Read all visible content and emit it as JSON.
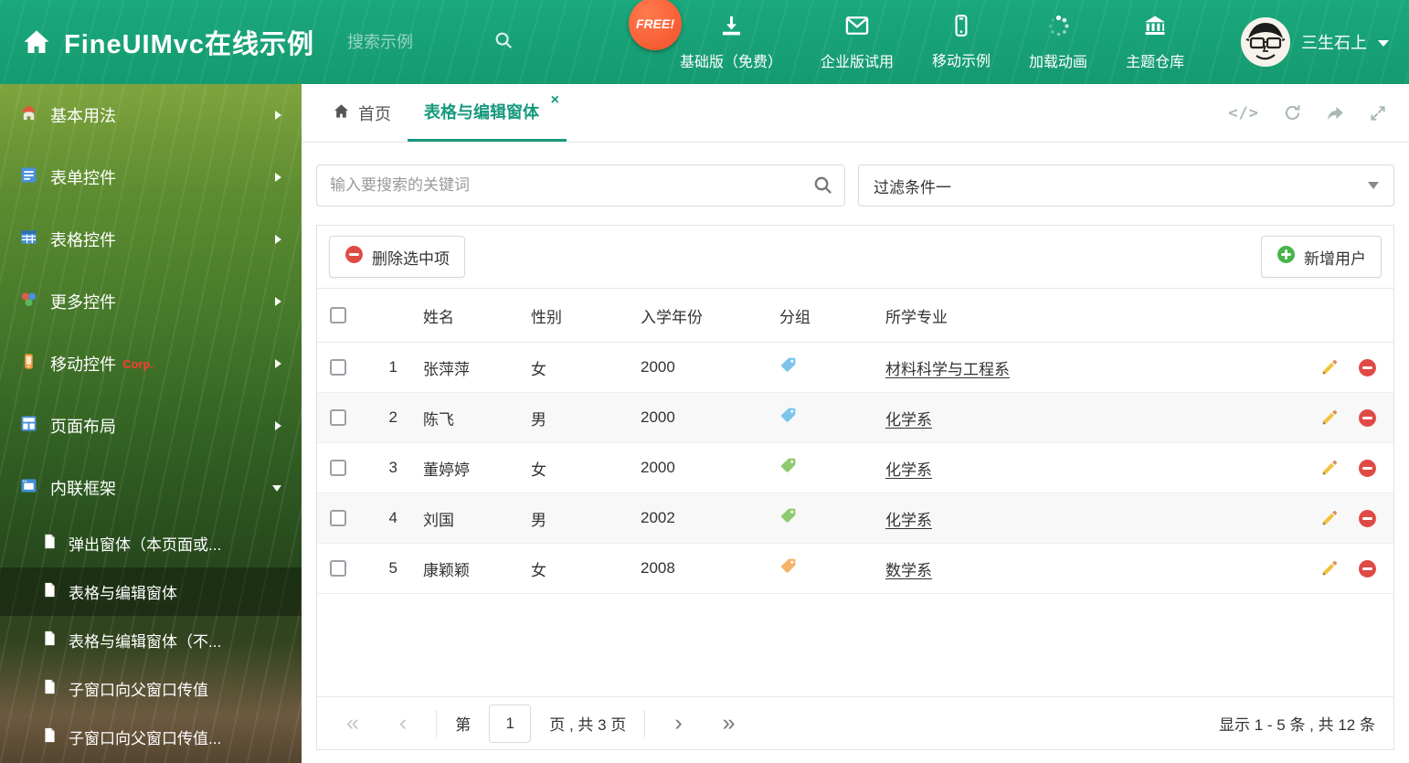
{
  "header": {
    "title": "FineUIMvc在线示例",
    "search_placeholder": "搜索示例",
    "free_badge": "FREE!",
    "nav": [
      {
        "label": "基础版（免费）",
        "icon": "download-icon"
      },
      {
        "label": "企业版试用",
        "icon": "envelope-icon"
      },
      {
        "label": "移动示例",
        "icon": "phone-icon"
      },
      {
        "label": "加载动画",
        "icon": "spinner-icon"
      },
      {
        "label": "主题仓库",
        "icon": "bank-icon"
      }
    ],
    "user": "三生石上"
  },
  "sidebar": {
    "items": [
      {
        "label": "基本用法",
        "icon": "home-icon"
      },
      {
        "label": "表单控件",
        "icon": "form-icon"
      },
      {
        "label": "表格控件",
        "icon": "table-icon"
      },
      {
        "label": "更多控件",
        "icon": "widgets-icon"
      },
      {
        "label": "移动控件",
        "badge": "Corp.",
        "icon": "mobile-icon"
      },
      {
        "label": "页面布局",
        "icon": "layout-icon"
      },
      {
        "label": "内联框架",
        "icon": "frame-icon",
        "expanded": true
      }
    ],
    "subitems": [
      {
        "label": "弹出窗体（本页面或..."
      },
      {
        "label": "表格与编辑窗体",
        "active": true
      },
      {
        "label": "表格与编辑窗体（不..."
      },
      {
        "label": "子窗口向父窗口传值"
      },
      {
        "label": "子窗口向父窗口传值..."
      }
    ]
  },
  "tabs": {
    "home": "首页",
    "active": "表格与编辑窗体"
  },
  "search": {
    "placeholder": "输入要搜索的关键词",
    "filter": "过滤条件一"
  },
  "toolbar": {
    "delete": "删除选中项",
    "add": "新增用户"
  },
  "table": {
    "headers": {
      "name": "姓名",
      "gender": "性别",
      "year": "入学年份",
      "group": "分组",
      "major": "所学专业"
    },
    "rows": [
      {
        "num": "1",
        "name": "张萍萍",
        "gender": "女",
        "year": "2000",
        "tag_color": "#7cc5ea",
        "major": "材料科学与工程系"
      },
      {
        "num": "2",
        "name": "陈飞",
        "gender": "男",
        "year": "2000",
        "tag_color": "#7cc5ea",
        "major": "化学系"
      },
      {
        "num": "3",
        "name": "董婷婷",
        "gender": "女",
        "year": "2000",
        "tag_color": "#8fca6f",
        "major": "化学系"
      },
      {
        "num": "4",
        "name": "刘国",
        "gender": "男",
        "year": "2002",
        "tag_color": "#8fca6f",
        "major": "化学系"
      },
      {
        "num": "5",
        "name": "康颖颖",
        "gender": "女",
        "year": "2008",
        "tag_color": "#f6b26b",
        "major": "数学系"
      }
    ]
  },
  "pagination": {
    "prefix": "第",
    "page": "1",
    "suffix": "页 , 共 3 页",
    "summary": "显示 1 - 5 条 , 共 12 条"
  },
  "icons": {
    "close": "×",
    "code": "</>",
    "pager_first": "«",
    "pager_prev": "‹",
    "pager_next": "›",
    "pager_last": "»"
  },
  "colors": {
    "accent": "#18a076",
    "tab_active": "#17997d",
    "badge": "#f4502a",
    "corp_badge": "#ff3b2f"
  }
}
